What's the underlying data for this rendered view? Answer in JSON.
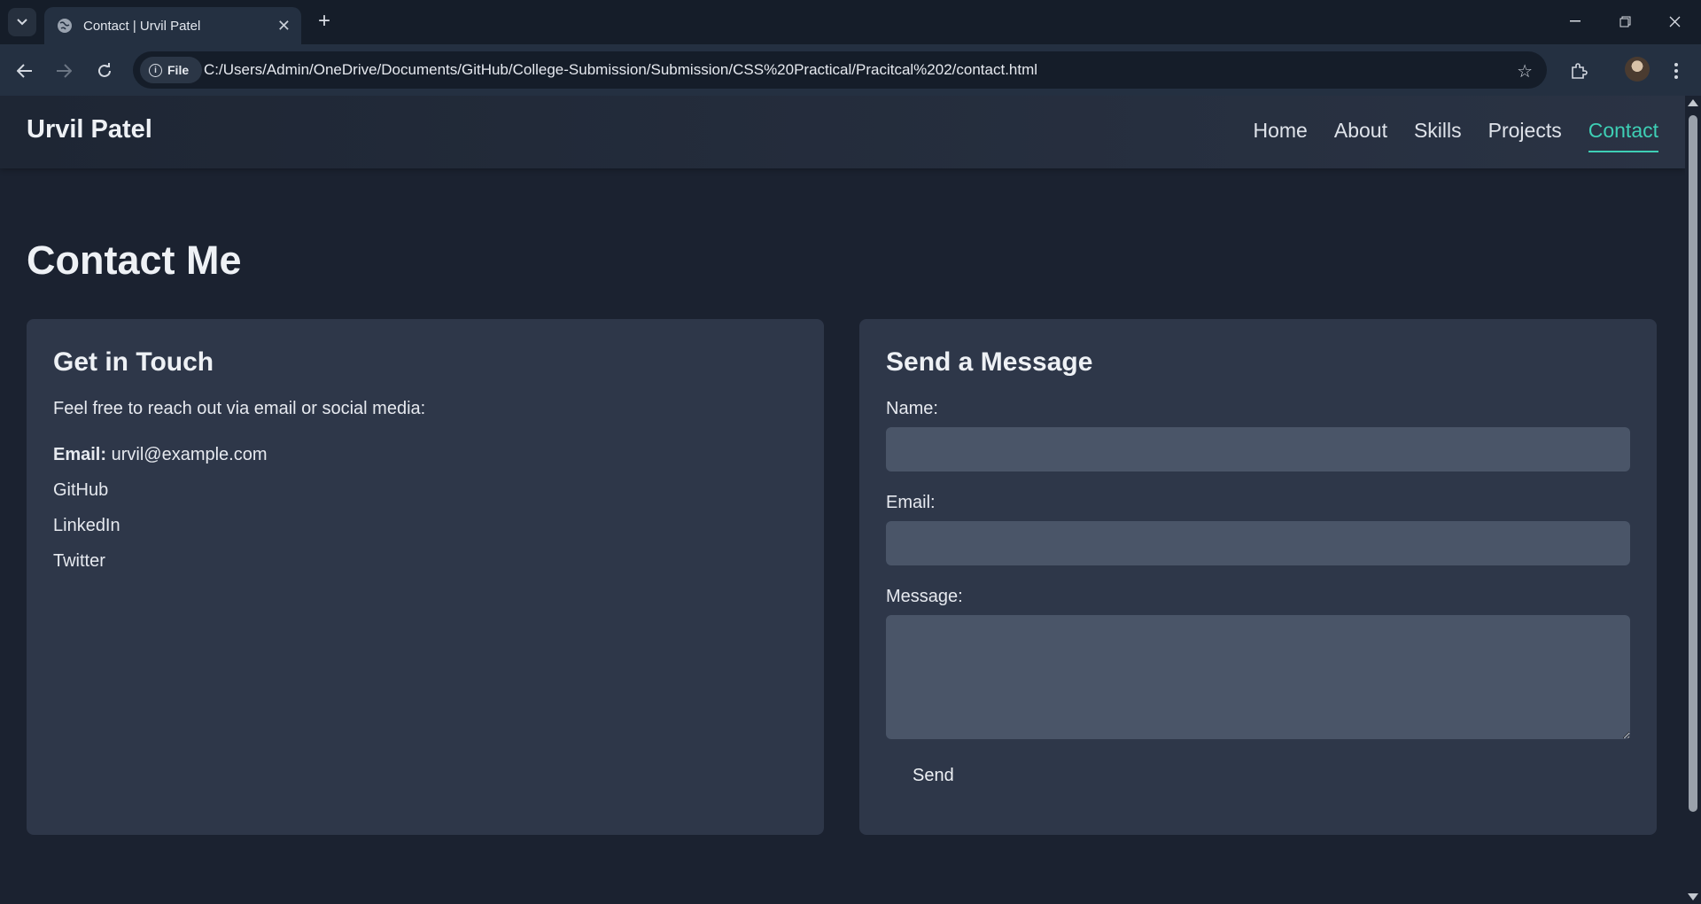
{
  "browser": {
    "tab_title": "Contact | Urvil Patel",
    "address_chip": "File",
    "url": "C:/Users/Admin/OneDrive/Documents/GitHub/College-Submission/Submission/CSS%20Practical/Pracitcal%202/contact.html"
  },
  "site": {
    "brand": "Urvil Patel",
    "accent_color": "#3ecfb5",
    "nav": [
      {
        "label": "Home"
      },
      {
        "label": "About"
      },
      {
        "label": "Skills"
      },
      {
        "label": "Projects"
      },
      {
        "label": "Contact",
        "active": true
      }
    ]
  },
  "page": {
    "title": "Contact Me"
  },
  "touch": {
    "heading": "Get in Touch",
    "intro": "Feel free to reach out via email or social media:",
    "email_label": "Email:",
    "email_value": "urvil@example.com",
    "links": [
      "GitHub",
      "LinkedIn",
      "Twitter"
    ]
  },
  "form": {
    "heading": "Send a Message",
    "name_label": "Name:",
    "name_value": "",
    "email_label": "Email:",
    "email_value": "",
    "message_label": "Message:",
    "message_value": "",
    "submit_label": "Send"
  }
}
